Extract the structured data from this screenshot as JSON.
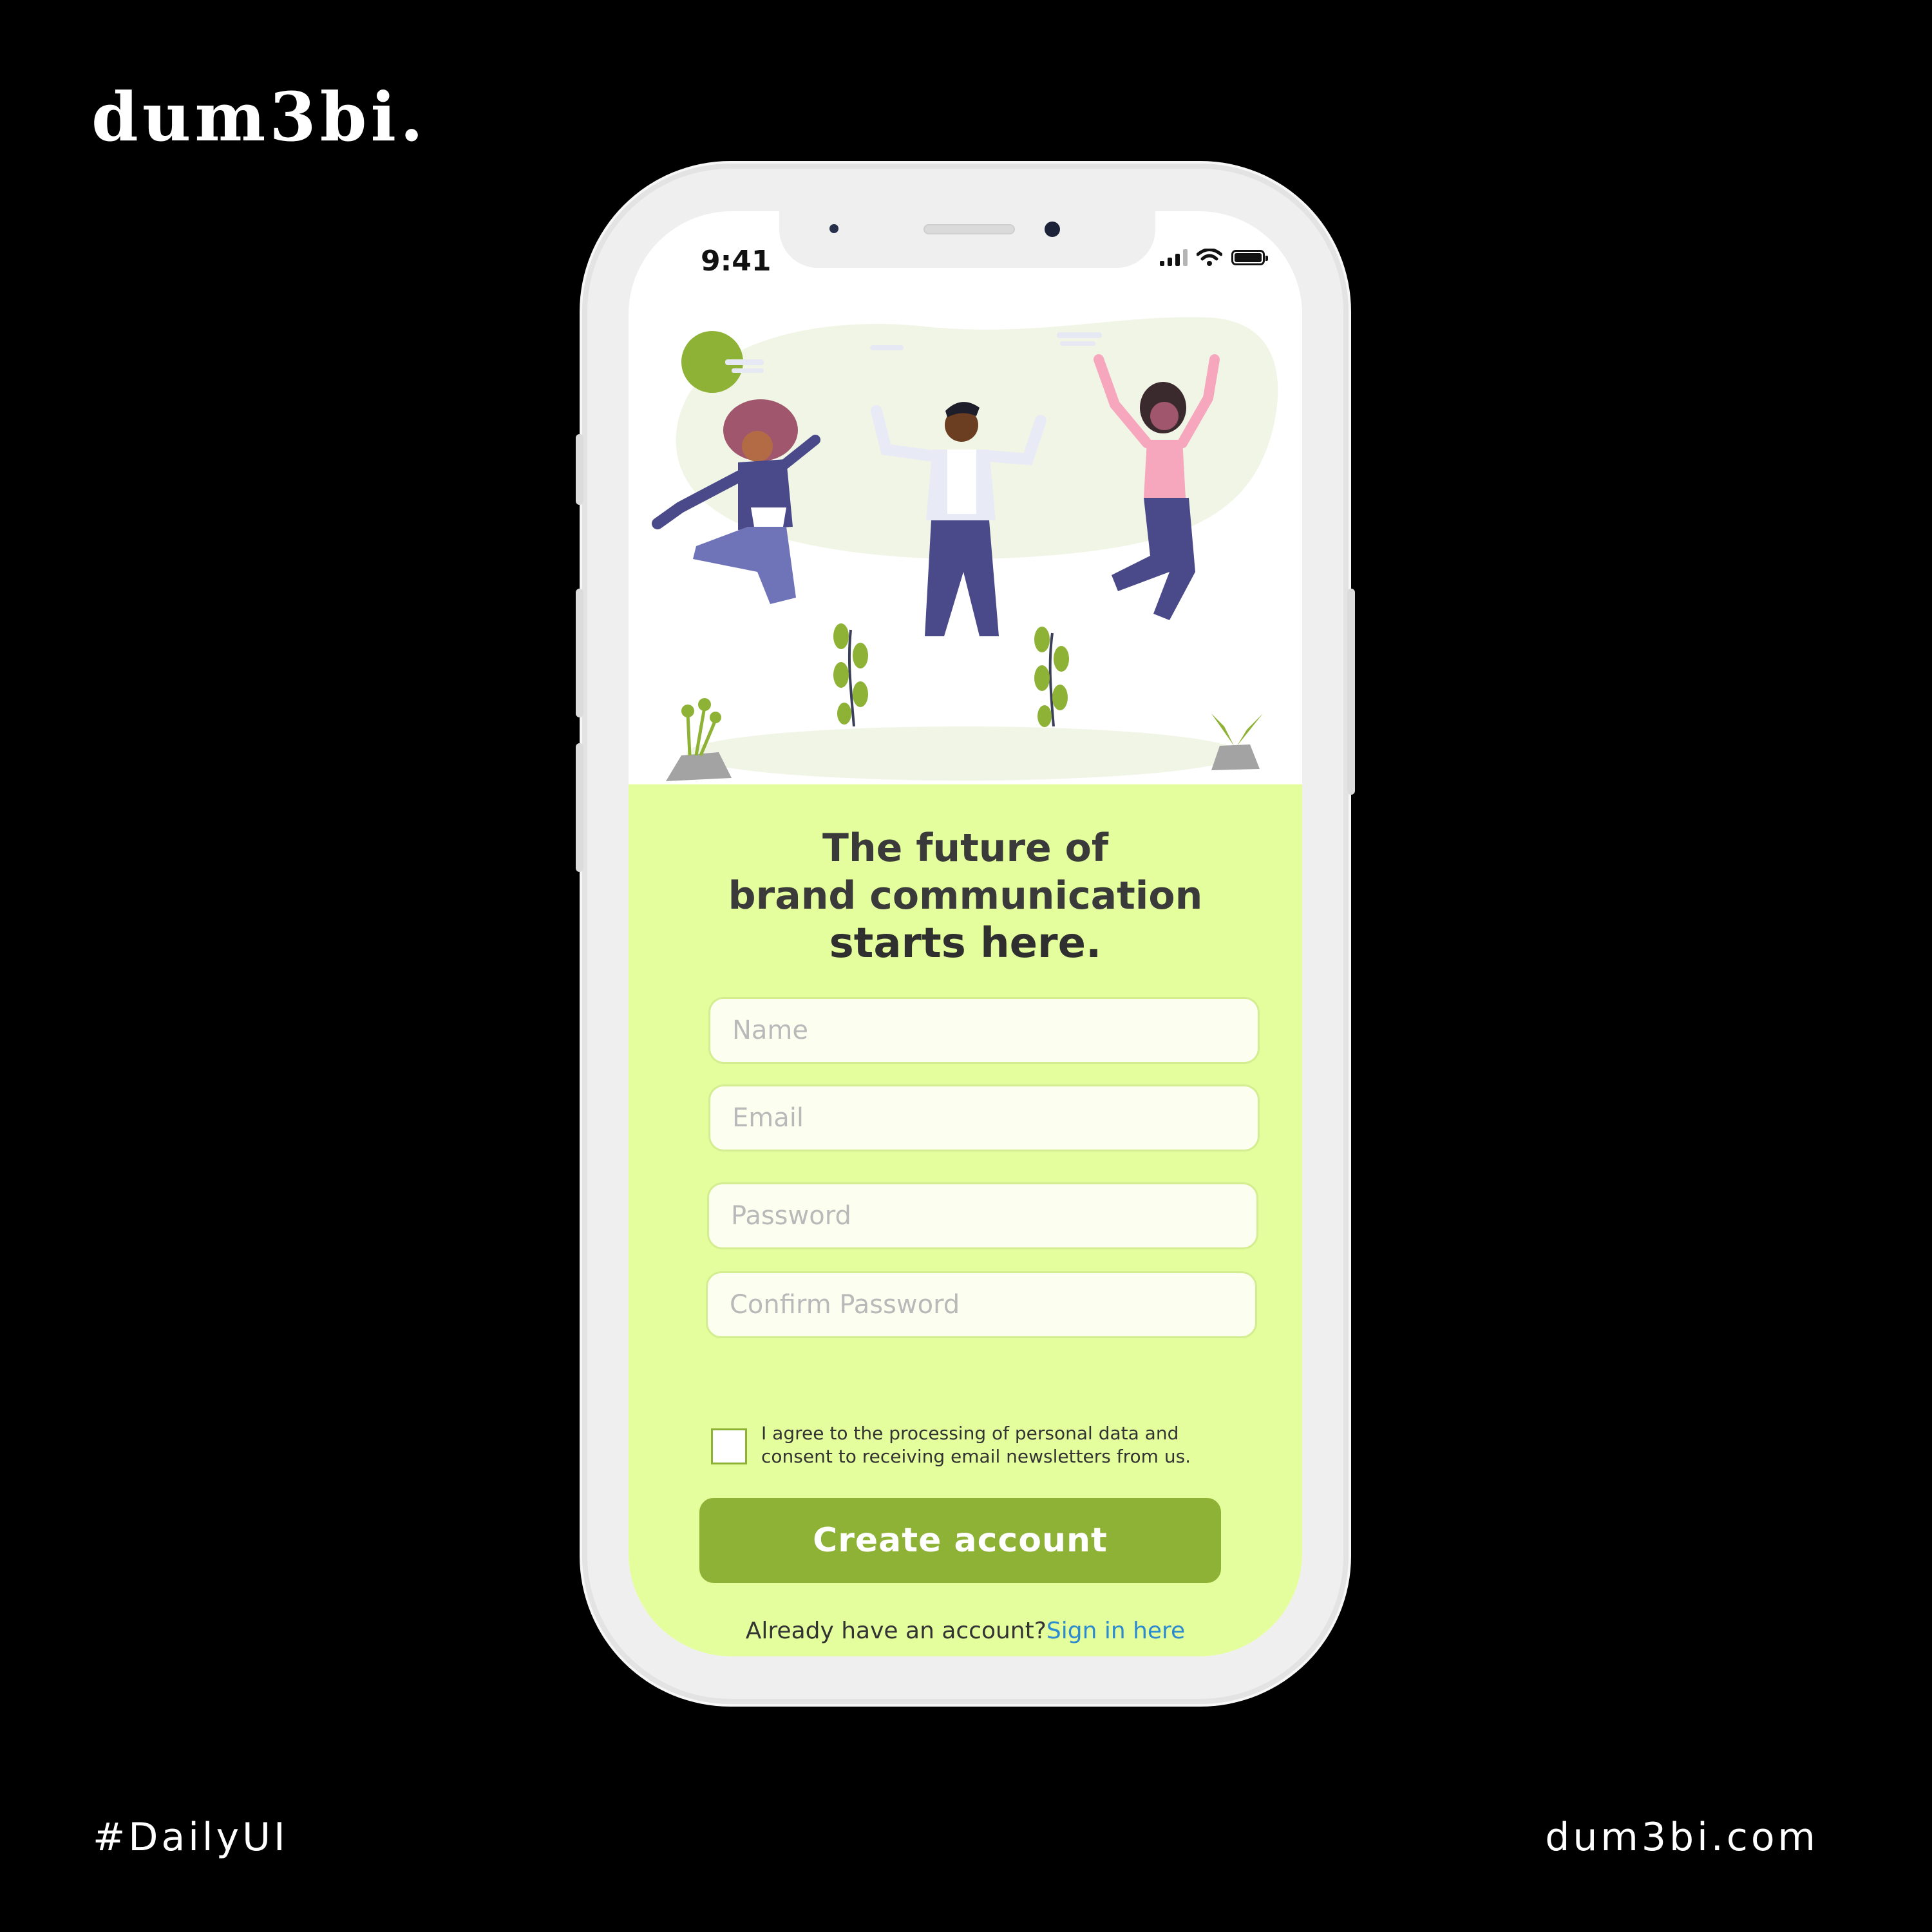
{
  "brand": {
    "logo": "dum3bi."
  },
  "footer": {
    "hashtag": "#DailyUI",
    "website": "dum3bi.com"
  },
  "status_bar": {
    "time": "9:41"
  },
  "signup": {
    "headline_line1": "The future of",
    "headline_line2": "brand communication",
    "headline_line3": "starts here.",
    "name_placeholder": "Name",
    "email_placeholder": "Email",
    "password_placeholder": "Password",
    "confirm_password_placeholder": "Confirm Password",
    "consent_line1": "I agree to the processing of personal data and",
    "consent_line2": "consent to receiving email newsletters from us.",
    "create_account_label": "Create account",
    "signin_prompt": "Already have an account?",
    "signin_link": "Sign in here"
  },
  "colors": {
    "background": "#000000",
    "panel": "#e4fe9d",
    "accent": "#8db235",
    "link": "#2b8ad0"
  },
  "icons": [
    "signal-icon",
    "wifi-icon",
    "battery-icon"
  ]
}
